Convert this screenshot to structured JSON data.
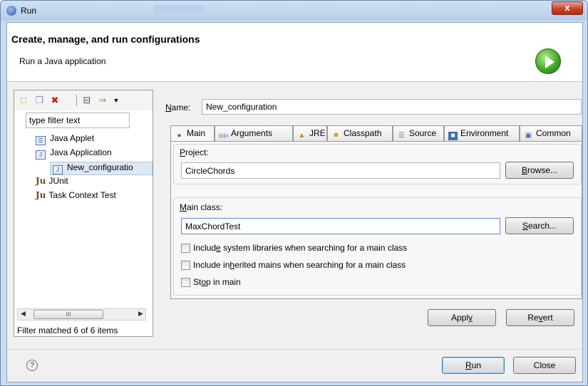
{
  "window": {
    "title": "Run",
    "close_glyph": "x"
  },
  "header": {
    "title": "Create, manage, and run configurations",
    "subtitle": "Run a Java application",
    "icon": "run-play-icon",
    "accent": "#3aa321"
  },
  "left": {
    "toolbar_icons": [
      "new-launch-config-icon",
      "duplicate-icon",
      "delete-icon",
      "collapse-all-icon",
      "filter-icon",
      "dropdown-icon"
    ],
    "filter_placeholder": "type filter text",
    "tree": [
      {
        "label": "Java Applet",
        "icon": "java-applet-icon",
        "level": 1
      },
      {
        "label": "Java Application",
        "icon": "java-application-icon",
        "level": 1
      },
      {
        "label": "New_configuratio",
        "icon": "java-application-icon",
        "level": 2,
        "selected": true
      },
      {
        "label": "JUnit",
        "icon": "junit-icon",
        "level": 1
      },
      {
        "label": "Task Context Test",
        "icon": "junit-icon",
        "level": 1
      }
    ],
    "scroll_grip": "III",
    "status": "Filter matched 6 of 6 items"
  },
  "main": {
    "name_label_underlined": "N",
    "name_label_rest": "ame:",
    "name_value": "New_configuration",
    "tabs": [
      {
        "label": "Main",
        "icon": "main-tab-icon",
        "active": true
      },
      {
        "label": "Arguments",
        "icon": "arguments-icon"
      },
      {
        "label": "JRE",
        "icon": "jre-icon"
      },
      {
        "label": "Classpath",
        "icon": "classpath-icon"
      },
      {
        "label": "Source",
        "icon": "source-icon"
      },
      {
        "label": "Environment",
        "icon": "environment-icon"
      },
      {
        "label": "Common",
        "icon": "common-icon"
      }
    ],
    "project": {
      "label_underlined": "P",
      "label_rest": "roject:",
      "value": "CircleChords",
      "browse_underlined": "B",
      "browse_rest": "rowse..."
    },
    "main_class": {
      "label_underlined": "M",
      "label_rest": "ain class:",
      "value": "MaxChordTest",
      "search_underlined": "S",
      "search_rest": "earch..."
    },
    "checks": [
      {
        "pre": "Includ",
        "u": "e",
        "post": " system libraries when searching for a main class",
        "checked": false
      },
      {
        "pre": "Include in",
        "u": "h",
        "post": "erited mains when searching for a main class",
        "checked": false
      },
      {
        "pre": "St",
        "u": "o",
        "post": "p in main",
        "checked": false
      }
    ],
    "apply_pre": "Appl",
    "apply_u": "y",
    "revert_pre": "Re",
    "revert_u": "v",
    "revert_post": "ert"
  },
  "footer": {
    "help_glyph": "?",
    "run_u": "R",
    "run_rest": "un",
    "close_label": "Close"
  }
}
